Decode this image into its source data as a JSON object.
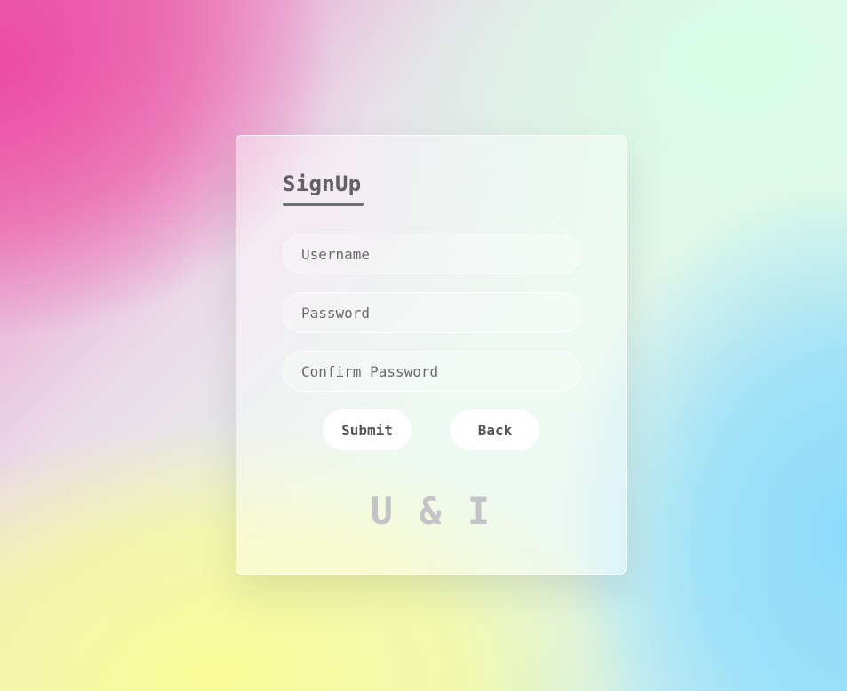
{
  "form": {
    "title": "SignUp",
    "username": {
      "placeholder": "Username",
      "value": ""
    },
    "password": {
      "placeholder": "Password",
      "value": ""
    },
    "confirm_password": {
      "placeholder": "Confirm Password",
      "value": ""
    },
    "submit_label": "Submit",
    "back_label": "Back"
  },
  "brand": {
    "logo_text": "U & I"
  },
  "colors": {
    "accent_pink": "#ec48a0",
    "accent_yellow": "#f8fa96",
    "accent_blue": "#8cdcfc",
    "accent_mint": "#d7fce6",
    "title_text": "#606066",
    "logo_text": "#c3c3c8"
  }
}
